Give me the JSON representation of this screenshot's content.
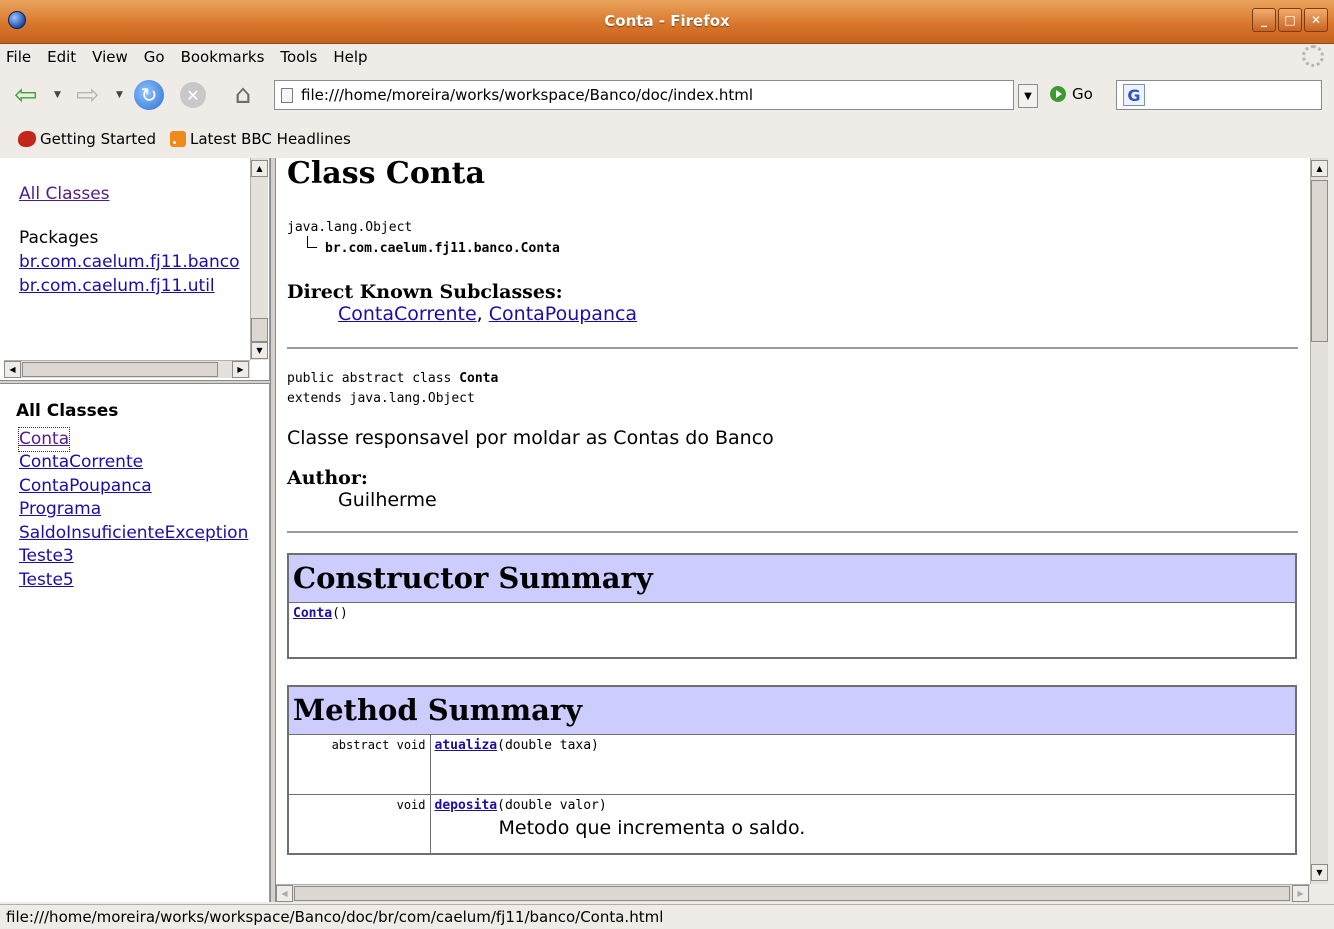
{
  "window": {
    "title": "Conta - Firefox"
  },
  "menu": {
    "file": "File",
    "edit": "Edit",
    "view": "View",
    "go": "Go",
    "bookmarks": "Bookmarks",
    "tools": "Tools",
    "help": "Help"
  },
  "nav": {
    "url": "file:///home/moreira/works/workspace/Banco/doc/index.html",
    "go_label": "Go",
    "search_value": ""
  },
  "bookmarks": {
    "items": [
      {
        "label": "Getting Started"
      },
      {
        "label": "Latest BBC Headlines"
      }
    ]
  },
  "packages_frame": {
    "all_classes_link": "All Classes",
    "packages_heading": "Packages",
    "packages": [
      "br.com.caelum.fj11.banco",
      "br.com.caelum.fj11.util"
    ]
  },
  "classes_frame": {
    "heading": "All Classes",
    "classes": [
      "Conta",
      "ContaCorrente",
      "ContaPoupanca",
      "Programa",
      "SaldoInsuficienteException",
      "Teste3",
      "Teste5"
    ]
  },
  "main": {
    "class_title": "Class Conta",
    "hierarchy_root": "java.lang.Object",
    "hierarchy_child": "br.com.caelum.fj11.banco.Conta",
    "subclasses_label": "Direct Known Subclasses:",
    "subclasses": [
      "ContaCorrente",
      "ContaPoupanca"
    ],
    "subclass_sep": ", ",
    "declaration_prefix": "public abstract class ",
    "declaration_name": "Conta",
    "declaration_extends": "extends java.lang.Object",
    "description": "Classe responsavel por moldar as Contas do Banco",
    "author_label": "Author:",
    "author": "Guilherme",
    "constructor_summary": {
      "title": "Constructor Summary",
      "rows": [
        {
          "name": "Conta",
          "params": "()"
        }
      ]
    },
    "method_summary": {
      "title": "Method Summary",
      "rows": [
        {
          "modifiers": "abstract  void",
          "name": "atualiza",
          "params": "(double taxa)",
          "desc": ""
        },
        {
          "modifiers": "void",
          "name": "deposita",
          "params": "(double valor)",
          "desc": "Metodo que incrementa o saldo."
        }
      ]
    }
  },
  "status": {
    "text": "file:///home/moreira/works/workspace/Banco/doc/br/com/caelum/fj11/banco/Conta.html"
  }
}
